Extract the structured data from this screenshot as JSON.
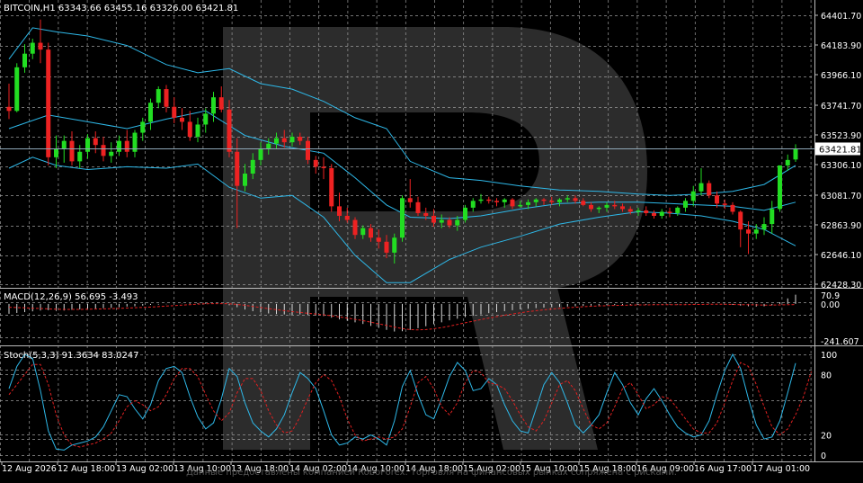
{
  "colors": {
    "background": "#000000",
    "grid": "#9a9a9a",
    "bull_candle": "#22dd22",
    "bear_candle": "#ee2222",
    "bollinger": "#2eb8e8",
    "macd_hist": "#d8d8d8",
    "macd_signal": "#e02020",
    "stoch_main": "#2eb8e8",
    "stoch_signal": "#e02020",
    "price_line": "#8fa8b8"
  },
  "watermark": {
    "logo": "R",
    "caption": "Данные предоставлены компанией RoboForex. Торговля на финансовых рынках сопряжена с рисками."
  },
  "main_panel": {
    "header": "BITCOIN,H1  63343.66 63455.16 63326.00 63421.81",
    "current_price_label": "63421.81",
    "y_ticks": [
      "64401.70",
      "64183.90",
      "63966.10",
      "63741.70",
      "63523.90",
      "63306.10",
      "63081.70",
      "62863.90",
      "62646.10",
      "62428.30"
    ]
  },
  "macd_panel": {
    "header": "MACD(12,26,9) 56.695 -3.493",
    "y_ticks": [
      "70.9",
      "0.00",
      "-241.607"
    ]
  },
  "stoch_panel": {
    "header": "Stoch(5,3,3) 91.3634 83.0247",
    "y_ticks": [
      "100",
      "80",
      "20",
      "0"
    ]
  },
  "x_axis": {
    "labels": [
      "12 Aug 2026",
      "12 Aug 18:00",
      "13 Aug 02:00",
      "13 Aug 10:00",
      "13 Aug 18:00",
      "14 Aug 02:00",
      "14 Aug 10:00",
      "14 Aug 18:00",
      "15 Aug 02:00",
      "15 Aug 10:00",
      "15 Aug 18:00",
      "16 Aug 09:00",
      "16 Aug 17:00",
      "17 Aug 01:00"
    ]
  },
  "chart_data": {
    "type": "candlestick",
    "symbol": "BITCOIN",
    "timeframe": "H1",
    "price_range": [
      62428.3,
      64401.7
    ],
    "last": {
      "open": 63343.66,
      "high": 63455.16,
      "low": 63326.0,
      "close": 63421.81
    },
    "candles": [
      [
        63730,
        63900,
        63640,
        63700
      ],
      [
        63700,
        64050,
        63690,
        64020
      ],
      [
        64020,
        64190,
        63980,
        64120
      ],
      [
        64120,
        64230,
        64080,
        64200
      ],
      [
        64200,
        64370,
        64050,
        64150
      ],
      [
        64150,
        64200,
        63300,
        63360
      ],
      [
        63360,
        63520,
        63280,
        63420
      ],
      [
        63420,
        63520,
        63320,
        63480
      ],
      [
        63480,
        63550,
        63300,
        63330
      ],
      [
        63330,
        63450,
        63280,
        63400
      ],
      [
        63400,
        63530,
        63350,
        63500
      ],
      [
        63500,
        63550,
        63390,
        63450
      ],
      [
        63450,
        63510,
        63330,
        63370
      ],
      [
        63370,
        63470,
        63320,
        63400
      ],
      [
        63400,
        63520,
        63370,
        63480
      ],
      [
        63480,
        63560,
        63360,
        63400
      ],
      [
        63400,
        63560,
        63360,
        63540
      ],
      [
        63540,
        63650,
        63480,
        63620
      ],
      [
        63620,
        63790,
        63560,
        63760
      ],
      [
        63760,
        63880,
        63720,
        63860
      ],
      [
        63860,
        63890,
        63690,
        63730
      ],
      [
        63730,
        63800,
        63610,
        63650
      ],
      [
        63650,
        63720,
        63560,
        63620
      ],
      [
        63620,
        63700,
        63480,
        63510
      ],
      [
        63510,
        63650,
        63470,
        63600
      ],
      [
        63600,
        63720,
        63540,
        63680
      ],
      [
        63680,
        63840,
        63620,
        63800
      ],
      [
        63800,
        63880,
        63690,
        63710
      ],
      [
        63710,
        63780,
        63360,
        63400
      ],
      [
        63400,
        63500,
        62840,
        63150
      ],
      [
        63150,
        63310,
        63110,
        63240
      ],
      [
        63240,
        63390,
        63200,
        63340
      ],
      [
        63340,
        63470,
        63300,
        63420
      ],
      [
        63420,
        63500,
        63380,
        63460
      ],
      [
        63460,
        63540,
        63420,
        63500
      ],
      [
        63500,
        63560,
        63430,
        63470
      ],
      [
        63470,
        63540,
        63440,
        63510
      ],
      [
        63510,
        63540,
        63450,
        63480
      ],
      [
        63480,
        63510,
        63310,
        63340
      ],
      [
        63340,
        63370,
        63240,
        63290
      ],
      [
        63290,
        63360,
        63200,
        63280
      ],
      [
        63280,
        63310,
        62960,
        63000
      ],
      [
        63000,
        63100,
        62890,
        62930
      ],
      [
        62930,
        62990,
        62880,
        62900
      ],
      [
        62900,
        62920,
        62760,
        62790
      ],
      [
        62790,
        62860,
        62760,
        62840
      ],
      [
        62840,
        62870,
        62740,
        62770
      ],
      [
        62770,
        62830,
        62690,
        62740
      ],
      [
        62740,
        62790,
        62620,
        62660
      ],
      [
        62660,
        62800,
        62580,
        62770
      ],
      [
        62770,
        63080,
        62740,
        63060
      ],
      [
        63060,
        63200,
        62990,
        63030
      ],
      [
        63030,
        63070,
        62930,
        62950
      ],
      [
        62950,
        62990,
        62900,
        62930
      ],
      [
        62930,
        62980,
        62850,
        62880
      ],
      [
        62880,
        62940,
        62840,
        62900
      ],
      [
        62900,
        62920,
        62840,
        62860
      ],
      [
        62860,
        62930,
        62820,
        62900
      ],
      [
        62900,
        63010,
        62880,
        62990
      ],
      [
        62990,
        63060,
        62960,
        63040
      ],
      [
        63040,
        63090,
        63020,
        63050
      ],
      [
        63050,
        63070,
        63020,
        63040
      ],
      [
        63040,
        63060,
        63000,
        63030
      ],
      [
        63030,
        63060,
        62990,
        63050
      ],
      [
        63050,
        63060,
        62980,
        63000
      ],
      [
        63000,
        63040,
        62990,
        63010
      ],
      [
        63010,
        63050,
        62980,
        63030
      ],
      [
        63030,
        63060,
        63000,
        63050
      ],
      [
        63050,
        63060,
        63010,
        63040
      ],
      [
        63040,
        63070,
        63010,
        63030
      ],
      [
        63030,
        63060,
        63000,
        63050
      ],
      [
        63050,
        63080,
        63030,
        63060
      ],
      [
        63060,
        63080,
        63020,
        63040
      ],
      [
        63040,
        63060,
        63000,
        63010
      ],
      [
        63010,
        63030,
        62960,
        62980
      ],
      [
        62980,
        63000,
        62950,
        62990
      ],
      [
        62990,
        63030,
        62960,
        63010
      ],
      [
        63010,
        63040,
        62980,
        63000
      ],
      [
        63000,
        63020,
        62960,
        62980
      ],
      [
        62980,
        63000,
        62940,
        62960
      ],
      [
        62960,
        62990,
        62930,
        62970
      ],
      [
        62970,
        63000,
        62930,
        62950
      ],
      [
        62950,
        62970,
        62910,
        62930
      ],
      [
        62930,
        62980,
        62910,
        62960
      ],
      [
        62960,
        62990,
        62920,
        62950
      ],
      [
        62950,
        63000,
        62930,
        62990
      ],
      [
        62990,
        63060,
        62960,
        63040
      ],
      [
        63040,
        63150,
        63000,
        63110
      ],
      [
        63110,
        63280,
        63080,
        63170
      ],
      [
        63170,
        63190,
        63060,
        63080
      ],
      [
        63080,
        63110,
        62990,
        63020
      ],
      [
        63020,
        63050,
        62980,
        63010
      ],
      [
        63010,
        63030,
        62940,
        62960
      ],
      [
        62960,
        62970,
        62700,
        62830
      ],
      [
        62830,
        62890,
        62650,
        62800
      ],
      [
        62800,
        62870,
        62760,
        62830
      ],
      [
        62830,
        62920,
        62790,
        62870
      ],
      [
        62870,
        63040,
        62800,
        62980
      ],
      [
        62980,
        63300,
        62960,
        63300
      ],
      [
        63300,
        63380,
        63260,
        63340
      ],
      [
        63343.66,
        63455.16,
        63326.0,
        63421.81
      ]
    ],
    "bollinger": {
      "upper": [
        [
          0,
          64080
        ],
        [
          3,
          64310
        ],
        [
          6,
          64280
        ],
        [
          10,
          64250
        ],
        [
          15,
          64180
        ],
        [
          20,
          64040
        ],
        [
          24,
          63980
        ],
        [
          28,
          64010
        ],
        [
          32,
          63900
        ],
        [
          36,
          63860
        ],
        [
          40,
          63770
        ],
        [
          44,
          63650
        ],
        [
          48,
          63570
        ],
        [
          51,
          63330
        ],
        [
          56,
          63210
        ],
        [
          60,
          63190
        ],
        [
          65,
          63150
        ],
        [
          70,
          63120
        ],
        [
          75,
          63110
        ],
        [
          80,
          63090
        ],
        [
          84,
          63080
        ],
        [
          88,
          63090
        ],
        [
          92,
          63110
        ],
        [
          96,
          63160
        ],
        [
          100,
          63300
        ]
      ],
      "middle": [
        [
          0,
          63570
        ],
        [
          5,
          63670
        ],
        [
          10,
          63620
        ],
        [
          15,
          63570
        ],
        [
          20,
          63640
        ],
        [
          25,
          63700
        ],
        [
          30,
          63520
        ],
        [
          35,
          63440
        ],
        [
          40,
          63390
        ],
        [
          44,
          63210
        ],
        [
          48,
          63010
        ],
        [
          51,
          62920
        ],
        [
          56,
          62910
        ],
        [
          60,
          62930
        ],
        [
          65,
          62980
        ],
        [
          70,
          63020
        ],
        [
          75,
          63030
        ],
        [
          80,
          63030
        ],
        [
          84,
          63020
        ],
        [
          88,
          63010
        ],
        [
          92,
          63000
        ],
        [
          96,
          62970
        ],
        [
          100,
          63030
        ]
      ],
      "lower": [
        [
          0,
          63280
        ],
        [
          3,
          63360
        ],
        [
          6,
          63300
        ],
        [
          10,
          63270
        ],
        [
          15,
          63290
        ],
        [
          20,
          63280
        ],
        [
          24,
          63310
        ],
        [
          28,
          63140
        ],
        [
          32,
          63060
        ],
        [
          36,
          63080
        ],
        [
          40,
          62920
        ],
        [
          44,
          62640
        ],
        [
          48,
          62440
        ],
        [
          51,
          62440
        ],
        [
          56,
          62610
        ],
        [
          60,
          62700
        ],
        [
          65,
          62780
        ],
        [
          70,
          62870
        ],
        [
          75,
          62920
        ],
        [
          80,
          62960
        ],
        [
          84,
          62950
        ],
        [
          88,
          62930
        ],
        [
          92,
          62890
        ],
        [
          96,
          62830
        ],
        [
          100,
          62710
        ]
      ]
    },
    "macd": {
      "range": [
        -241.607,
        70.9
      ],
      "histogram": [
        -60,
        -55,
        -50,
        -45,
        -40,
        -38,
        -42,
        -40,
        -36,
        -33,
        -30,
        -28,
        -26,
        -24,
        -20,
        -16,
        -14,
        -10,
        -6,
        -4,
        -2,
        0,
        2,
        4,
        6,
        4,
        2,
        0,
        -8,
        -20,
        -34,
        -44,
        -52,
        -58,
        -62,
        -64,
        -66,
        -64,
        -66,
        -70,
        -74,
        -84,
        -94,
        -102,
        -112,
        -122,
        -134,
        -146,
        -158,
        -168,
        -166,
        -158,
        -148,
        -136,
        -124,
        -112,
        -100,
        -90,
        -80,
        -72,
        -64,
        -56,
        -50,
        -44,
        -38,
        -33,
        -29,
        -25,
        -22,
        -20,
        -18,
        -16,
        -14,
        -12,
        -10,
        -9,
        -8,
        -7,
        -6,
        -6,
        -5,
        -5,
        -4,
        -4,
        -3,
        -3,
        -2,
        -1,
        0,
        2,
        1,
        -3,
        -6,
        -10,
        -14,
        -16,
        -14,
        -8,
        10,
        34,
        56.695
      ],
      "signal": [
        -20,
        -22,
        -24,
        -26,
        -28,
        -30,
        -32,
        -33,
        -33,
        -33,
        -32,
        -31,
        -30,
        -29,
        -27,
        -25,
        -23,
        -21,
        -19,
        -16,
        -13,
        -10,
        -7,
        -4,
        -1,
        1,
        2,
        2,
        1,
        -3,
        -8,
        -15,
        -22,
        -29,
        -35,
        -41,
        -47,
        -52,
        -57,
        -61,
        -66,
        -72,
        -79,
        -86,
        -94,
        -102,
        -111,
        -121,
        -131,
        -141,
        -150,
        -156,
        -158,
        -156,
        -151,
        -144,
        -135,
        -125,
        -115,
        -105,
        -95,
        -86,
        -77,
        -69,
        -61,
        -54,
        -47,
        -41,
        -36,
        -31,
        -27,
        -23,
        -20,
        -17,
        -14,
        -12,
        -10,
        -9,
        -8,
        -7,
        -6,
        -6,
        -5,
        -5,
        -4,
        -4,
        -4,
        -3,
        -3,
        -2,
        -2,
        -2,
        -3,
        -4,
        -5,
        -6,
        -7,
        -7,
        -6,
        -5,
        -3.493
      ]
    },
    "stochastic": {
      "range": [
        0,
        100
      ],
      "main": [
        66,
        88,
        100,
        96,
        64,
        24,
        6,
        5,
        10,
        12,
        14,
        18,
        28,
        44,
        60,
        58,
        46,
        36,
        50,
        74,
        86,
        88,
        82,
        58,
        38,
        26,
        32,
        56,
        86,
        78,
        52,
        32,
        24,
        18,
        26,
        40,
        62,
        82,
        76,
        66,
        44,
        20,
        10,
        12,
        18,
        16,
        20,
        16,
        10,
        34,
        68,
        84,
        60,
        40,
        36,
        56,
        78,
        92,
        84,
        64,
        66,
        76,
        70,
        50,
        34,
        24,
        22,
        46,
        70,
        82,
        72,
        52,
        30,
        22,
        30,
        40,
        62,
        82,
        70,
        52,
        40,
        56,
        66,
        54,
        40,
        28,
        22,
        18,
        20,
        34,
        60,
        84,
        100,
        86,
        56,
        30,
        16,
        18,
        34,
        62,
        91.3634
      ],
      "signal": [
        60,
        70,
        80,
        90,
        90,
        70,
        40,
        20,
        10,
        8,
        10,
        12,
        16,
        22,
        34,
        48,
        54,
        50,
        44,
        48,
        60,
        76,
        86,
        86,
        78,
        60,
        44,
        34,
        42,
        62,
        76,
        76,
        64,
        44,
        30,
        22,
        24,
        38,
        56,
        72,
        80,
        74,
        58,
        36,
        20,
        14,
        16,
        18,
        16,
        18,
        26,
        48,
        72,
        78,
        66,
        48,
        40,
        52,
        72,
        84,
        82,
        72,
        70,
        66,
        54,
        40,
        28,
        24,
        34,
        52,
        70,
        74,
        64,
        46,
        30,
        26,
        32,
        48,
        66,
        72,
        60,
        46,
        50,
        58,
        56,
        46,
        36,
        26,
        22,
        22,
        32,
        52,
        74,
        92,
        88,
        70,
        48,
        28,
        20,
        26,
        40,
        58,
        83.0247
      ]
    }
  }
}
